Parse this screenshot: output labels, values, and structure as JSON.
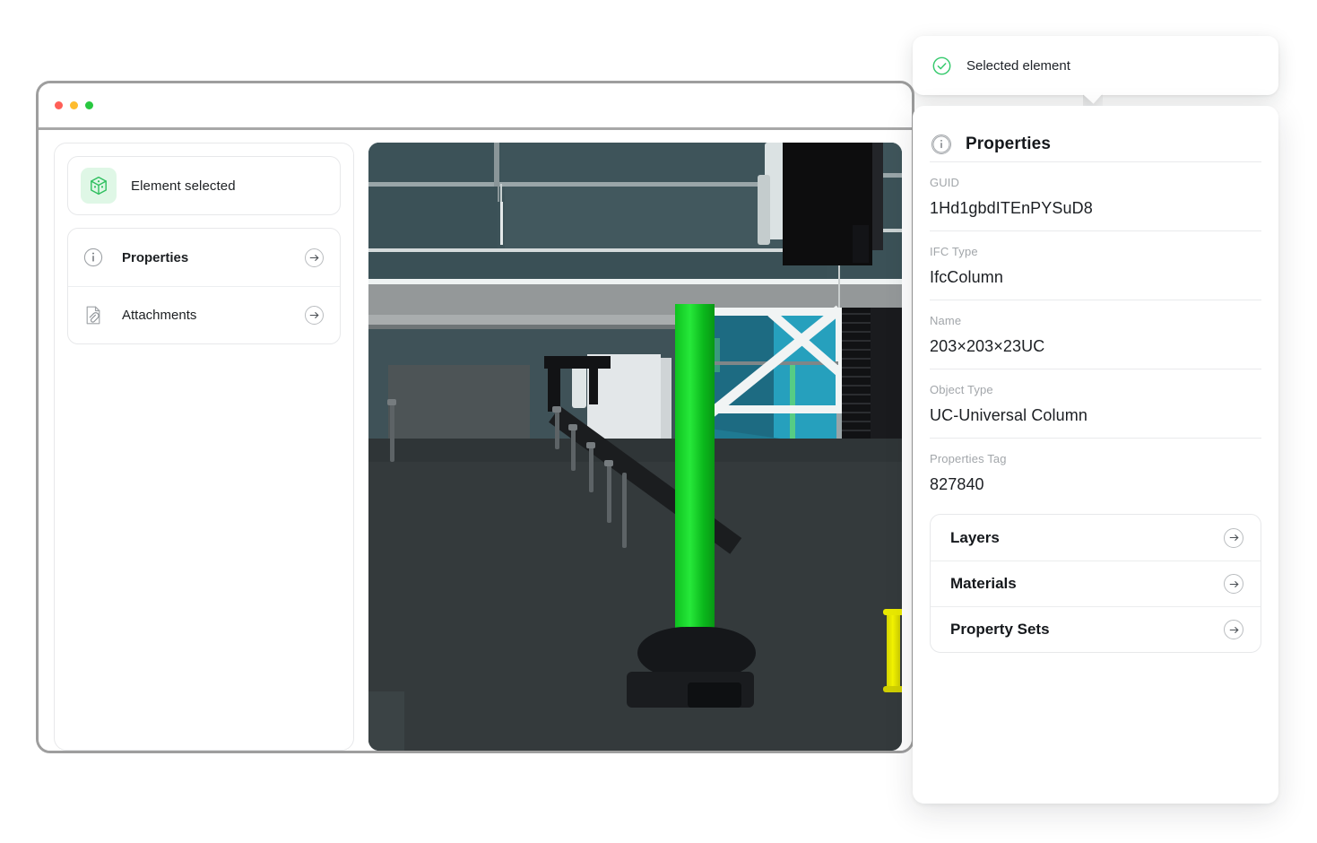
{
  "window": {
    "traffic_lights": [
      "close",
      "minimize",
      "maximize"
    ],
    "colors": {
      "close": "#ff5f57",
      "minimize": "#febc2e",
      "maximize": "#28c840"
    }
  },
  "sidebar": {
    "status": {
      "icon": "cube-icon",
      "label": "Element selected",
      "accent": "#2fbf5f",
      "chip_bg": "#dff7e6"
    },
    "menu": [
      {
        "icon": "info-circle-icon",
        "label": "Properties",
        "bold": true,
        "action_icon": "arrow-right-circle-icon"
      },
      {
        "icon": "document-attachment-icon",
        "label": "Attachments",
        "bold": false,
        "action_icon": "arrow-right-circle-icon"
      }
    ]
  },
  "viewport": {
    "name": "3d-model-viewport",
    "selected_element_color": "#26e83a",
    "bollard_color": "#f4f400",
    "glass_color": "#3d5359",
    "teal_room_color": "#1d6b82",
    "floor_color": "#33393b"
  },
  "tooltip": {
    "icon": "check-circle-icon",
    "icon_color": "#33c96b",
    "label": "Selected element"
  },
  "properties_panel": {
    "icon": "info-circle-icon",
    "title": "Properties",
    "fields": [
      {
        "key": "GUID",
        "value": "1Hd1gbdITEnPYSuD8"
      },
      {
        "key": "IFC Type",
        "value": "IfcColumn"
      },
      {
        "key": "Name",
        "value": "203×203×23UC"
      },
      {
        "key": "Object Type",
        "value": "UC-Universal Column"
      },
      {
        "key": "Properties Tag",
        "value": "827840"
      }
    ],
    "sub_sections": [
      {
        "label": "Layers",
        "action_icon": "arrow-right-circle-icon"
      },
      {
        "label": "Materials",
        "action_icon": "arrow-right-circle-icon"
      },
      {
        "label": "Property Sets",
        "action_icon": "arrow-right-circle-icon"
      }
    ]
  }
}
